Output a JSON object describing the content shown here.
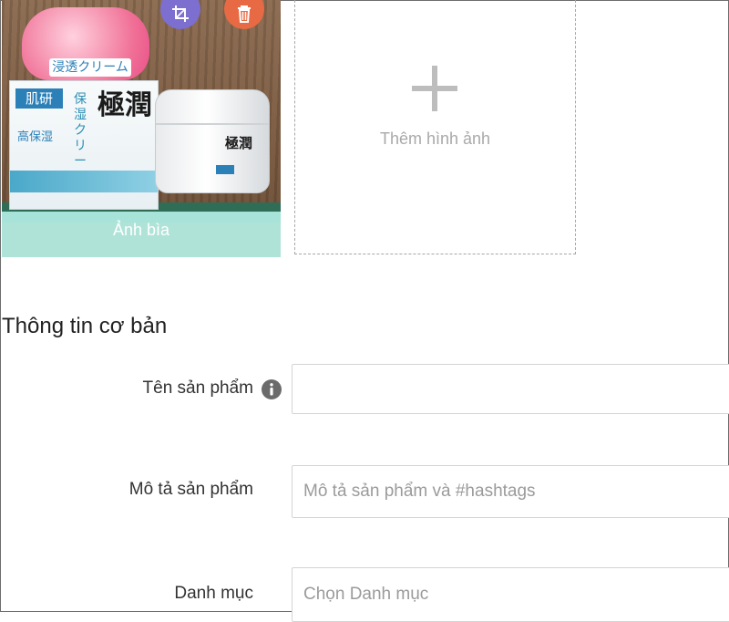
{
  "images": {
    "cover_caption": "Ảnh bìa",
    "add_image_label": "Thêm hình ảnh",
    "cover_product_text": {
      "bubble": "浸透クリーム",
      "brand": "極潤",
      "sub": "保湿クリーム",
      "high": "高保湿",
      "logo": "肌研",
      "jar_brand": "極潤"
    }
  },
  "basic_info": {
    "title": "Thông tin cơ bản",
    "product_name": {
      "label": "Tên sản phẩm",
      "placeholder": ""
    },
    "product_description": {
      "label": "Mô tả sản phẩm",
      "placeholder": "Mô tả sản phẩm và #hashtags"
    },
    "category": {
      "label": "Danh mục",
      "placeholder": "Chọn Danh mục"
    }
  },
  "icons": {
    "crop": "crop-icon",
    "delete": "trash-icon",
    "add": "plus-icon",
    "info": "info-icon"
  },
  "colors": {
    "crop_button": "#7c6fd0",
    "delete_button": "#e86a44",
    "cover_caption_bg": "#b2eee4"
  }
}
